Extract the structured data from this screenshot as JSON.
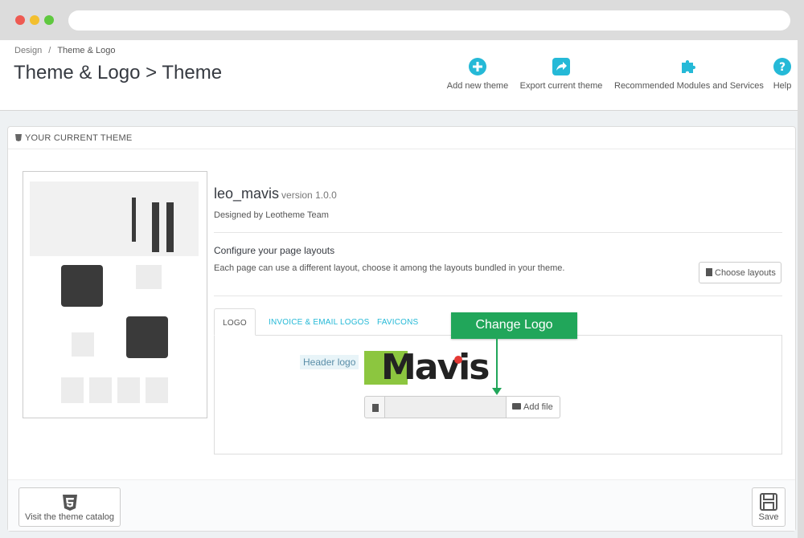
{
  "breadcrumb": {
    "parent": "Design",
    "separator": "/",
    "current": "Theme & Logo"
  },
  "page_title": "Theme & Logo > Theme",
  "toolbar": {
    "add_theme_label": "Add new theme",
    "export_label": "Export current theme",
    "modules_label": "Recommended Modules and Services",
    "help_label": "Help",
    "icon_color": "#25b9d7"
  },
  "panel": {
    "heading": "YOUR CURRENT THEME"
  },
  "theme": {
    "name": "leo_mavis",
    "version": "version 1.0.0",
    "designed_by": "Designed by Leotheme Team"
  },
  "layouts": {
    "title": "Configure your page layouts",
    "description": "Each page can use a different layout, choose it among the layouts bundled in your theme.",
    "button_label": "Choose layouts"
  },
  "tabs": [
    {
      "label": "LOGO",
      "active": true
    },
    {
      "label": "INVOICE & EMAIL LOGOS",
      "active": false
    },
    {
      "label": "FAVICONS",
      "active": false
    }
  ],
  "logo": {
    "field_label": "Header logo",
    "brand_text": "Mavis",
    "add_file_label": "Add file"
  },
  "callout": {
    "text": "Change Logo",
    "color": "#21a65a"
  },
  "footer": {
    "catalog_label": "Visit the theme catalog",
    "save_label": "Save"
  }
}
